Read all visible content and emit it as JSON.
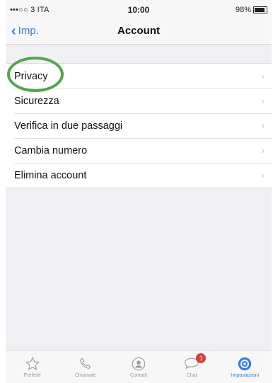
{
  "status_bar": {
    "carrier": "•••○○ 3 ITA",
    "time": "10:00",
    "battery": "98%"
  },
  "nav": {
    "back_label": "Imp.",
    "title": "Account"
  },
  "items": [
    {
      "label": "Privacy"
    },
    {
      "label": "Sicurezza"
    },
    {
      "label": "Verifica in due passaggi"
    },
    {
      "label": "Cambia numero"
    },
    {
      "label": "Elimina account"
    }
  ],
  "tabs": [
    {
      "label": "Preferiti",
      "icon": "star-icon"
    },
    {
      "label": "Chiamate",
      "icon": "phone-icon"
    },
    {
      "label": "Contatti",
      "icon": "contacts-icon"
    },
    {
      "label": "Chat",
      "icon": "chat-icon",
      "badge": "1"
    },
    {
      "label": "Impostazioni",
      "icon": "settings-icon",
      "active": true
    }
  ],
  "colors": {
    "accent": "#2f7df6",
    "annotation": "#4fa84a",
    "badge": "#e53935"
  }
}
